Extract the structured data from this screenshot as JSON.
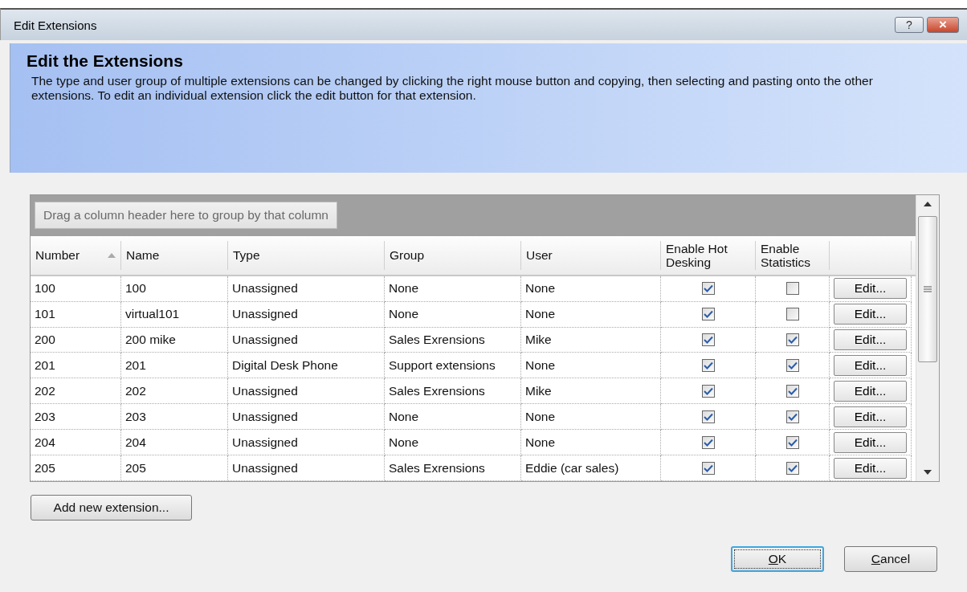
{
  "window": {
    "title": "Edit Extensions",
    "help": "?",
    "close": "×"
  },
  "header": {
    "title": "Edit the Extensions",
    "description": "The type and user group of multiple extensions can be changed by clicking the right mouse button and copying, then selecting and pasting onto the other extensions. To edit an individual extension click the edit button for that extension."
  },
  "table": {
    "group_hint": "Drag a column header here to group by that column",
    "columns": [
      {
        "label": "Number",
        "sorted": true
      },
      {
        "label": "Name",
        "sorted": false
      },
      {
        "label": "Type",
        "sorted": false
      },
      {
        "label": "Group",
        "sorted": false
      },
      {
        "label": "User",
        "sorted": false
      },
      {
        "label": "Enable Hot Desking",
        "sorted": false
      },
      {
        "label": "Enable Statistics",
        "sorted": false
      }
    ],
    "rows": [
      {
        "number": "100",
        "name": "100",
        "type": "Unassigned",
        "group": "None",
        "user": "None",
        "hot_desking": true,
        "statistics": false,
        "edit": "Edit..."
      },
      {
        "number": "101",
        "name": "virtual101",
        "type": "Unassigned",
        "group": "None",
        "user": "None",
        "hot_desking": true,
        "statistics": false,
        "edit": "Edit..."
      },
      {
        "number": "200",
        "name": "200 mike",
        "type": "Unassigned",
        "group": "Sales Exrensions",
        "user": "Mike",
        "hot_desking": true,
        "statistics": true,
        "edit": "Edit..."
      },
      {
        "number": "201",
        "name": "201",
        "type": "Digital Desk Phone",
        "group": "Support extensions",
        "user": "None",
        "hot_desking": true,
        "statistics": true,
        "edit": "Edit..."
      },
      {
        "number": "202",
        "name": "202",
        "type": "Unassigned",
        "group": "Sales Exrensions",
        "user": "Mike",
        "hot_desking": true,
        "statistics": true,
        "edit": "Edit..."
      },
      {
        "number": "203",
        "name": "203",
        "type": "Unassigned",
        "group": "None",
        "user": "None",
        "hot_desking": true,
        "statistics": true,
        "edit": "Edit..."
      },
      {
        "number": "204",
        "name": "204",
        "type": "Unassigned",
        "group": "None",
        "user": "None",
        "hot_desking": true,
        "statistics": true,
        "edit": "Edit..."
      },
      {
        "number": "205",
        "name": "205",
        "type": "Unassigned",
        "group": "Sales Exrensions",
        "user": "Eddie (car sales)",
        "hot_desking": true,
        "statistics": true,
        "edit": "Edit..."
      }
    ]
  },
  "add_button": {
    "label": "Add new extension..."
  },
  "buttons": [
    {
      "label": "OK",
      "default": true,
      "mnemonic": true
    },
    {
      "label": "Cancel",
      "default": false,
      "mnemonic": true
    }
  ]
}
